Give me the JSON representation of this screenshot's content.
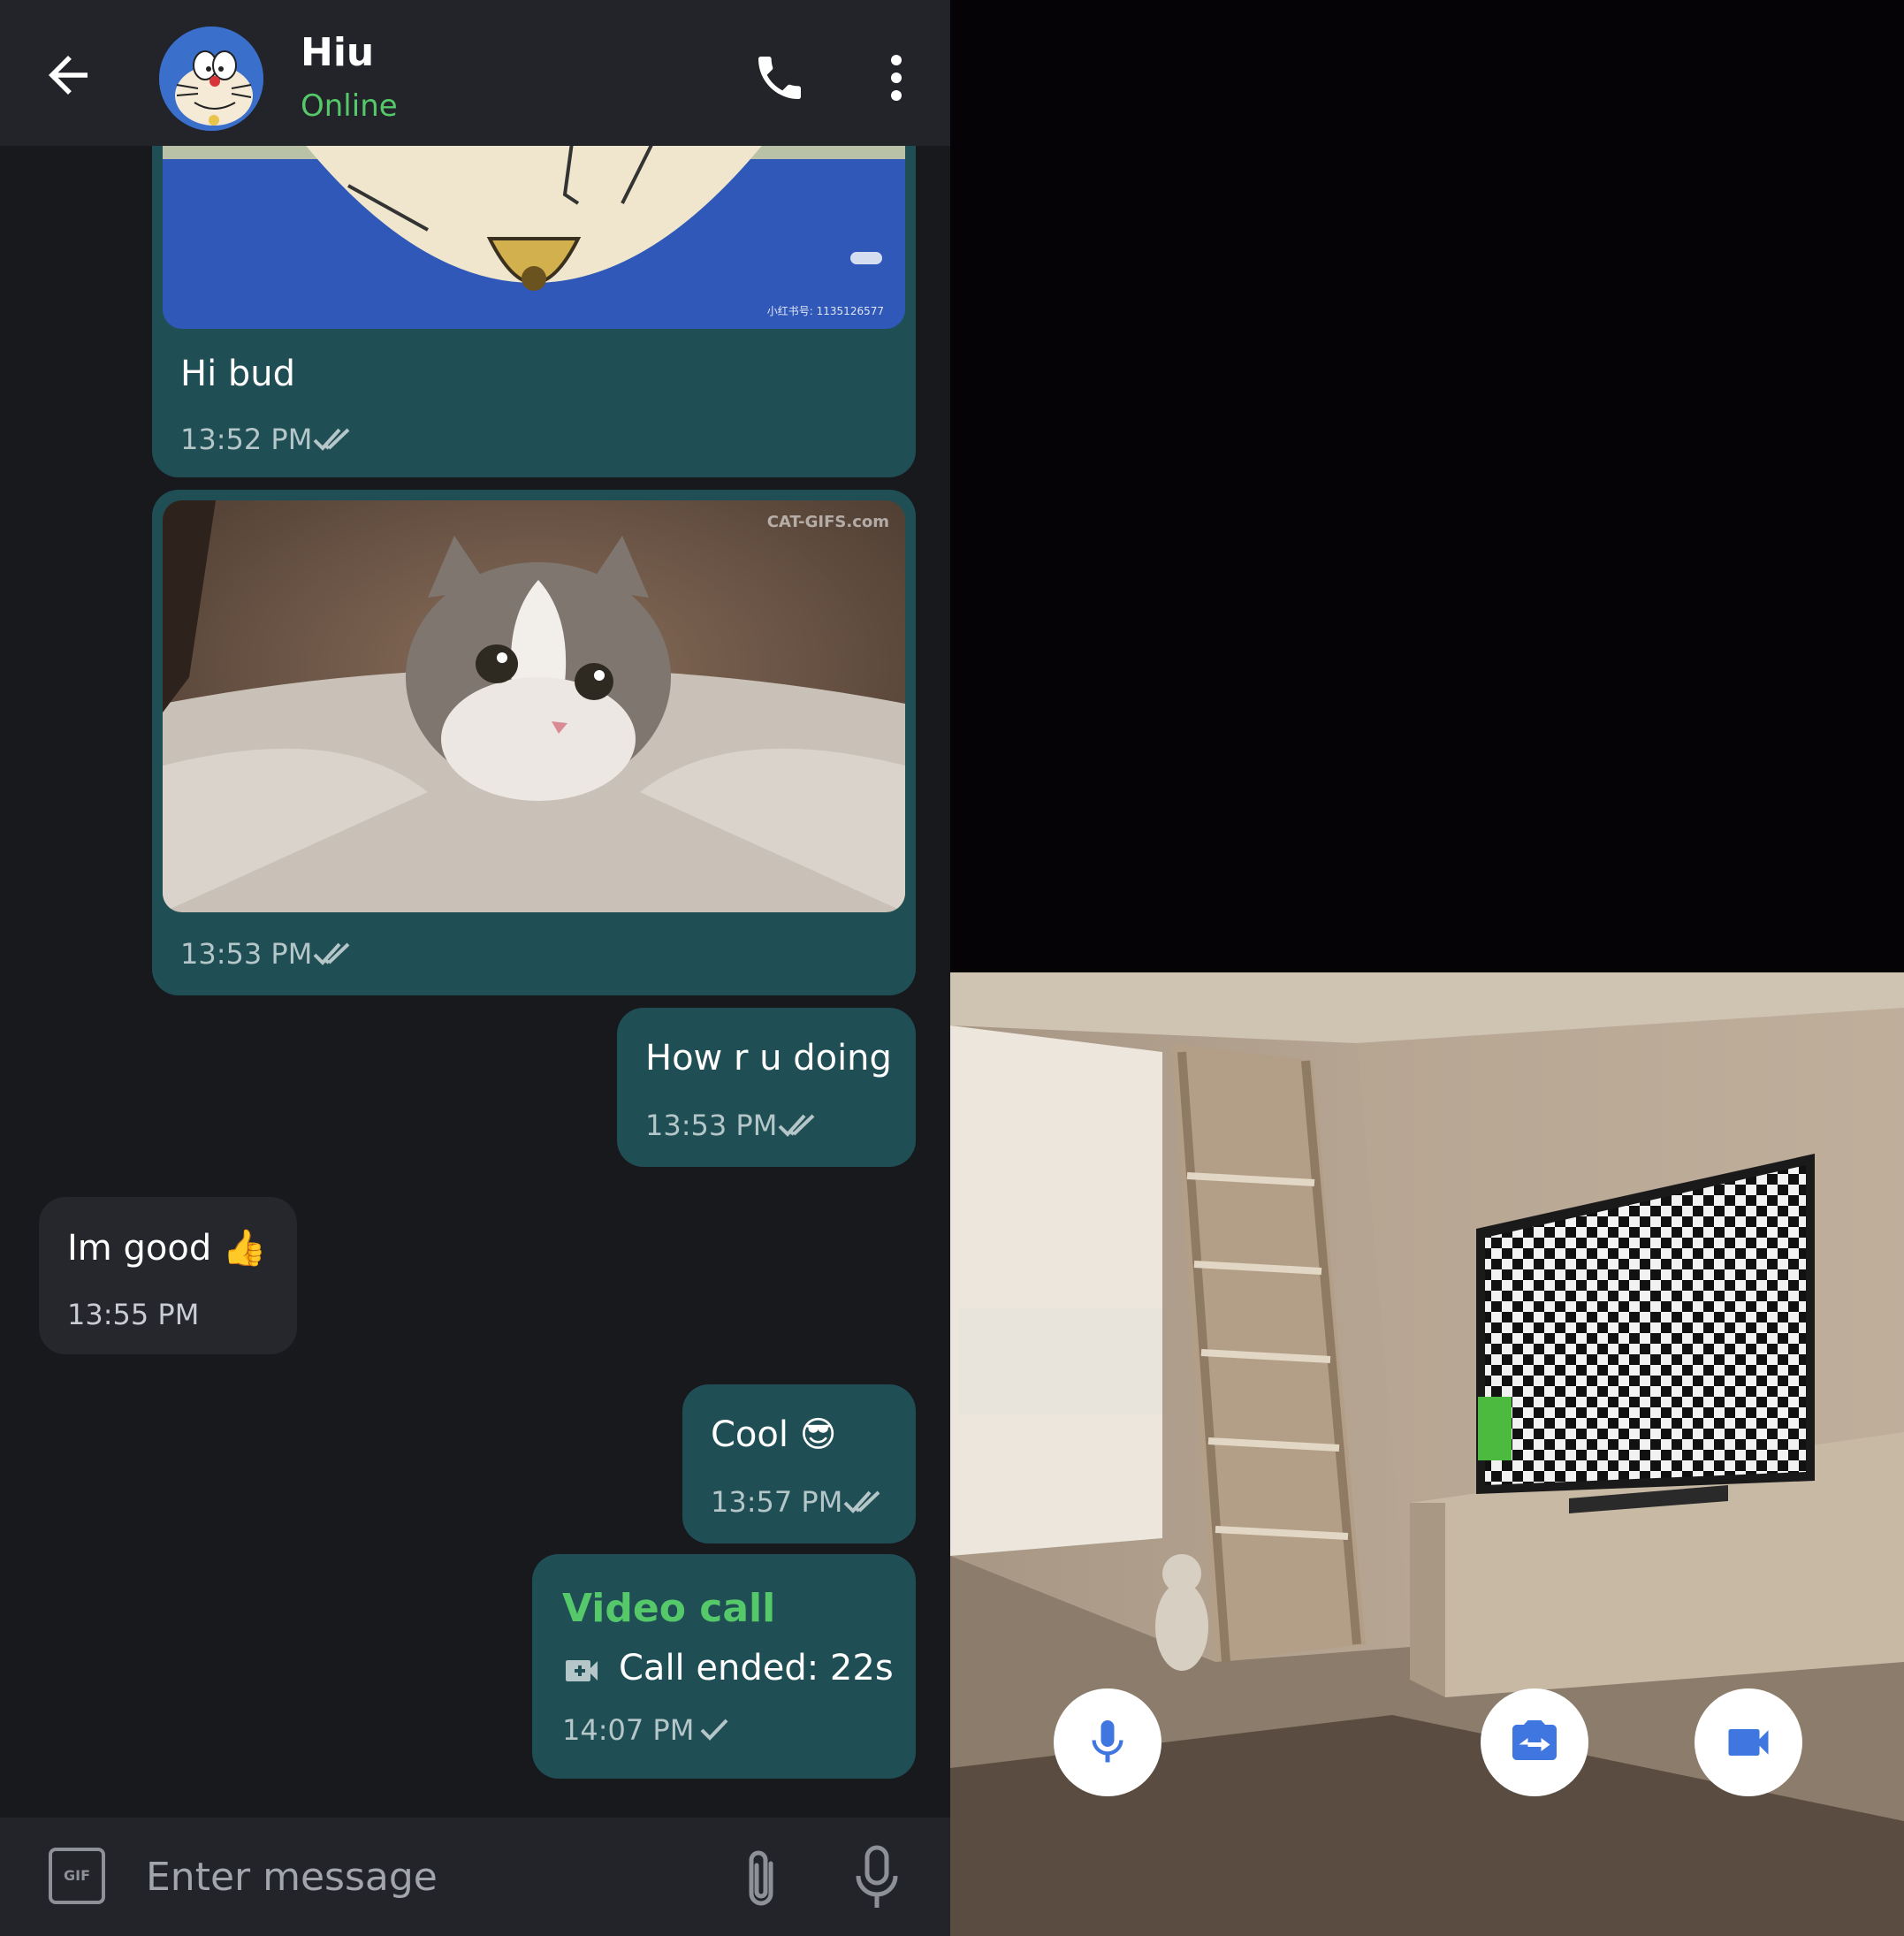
{
  "header": {
    "contact_name": "Hiu",
    "status": "Online"
  },
  "messages": [
    {
      "direction": "out",
      "type": "image",
      "caption": "Hi bud",
      "time": "13:52 PM",
      "status": "read",
      "image_watermark": "小红书号: 1135126577"
    },
    {
      "direction": "out",
      "type": "image",
      "caption": "",
      "time": "13:53 PM",
      "status": "read",
      "image_watermark": "CAT-GIFS.com"
    },
    {
      "direction": "out",
      "type": "text",
      "text": "How r u doing",
      "time": "13:53 PM",
      "status": "read"
    },
    {
      "direction": "in",
      "type": "text",
      "text": "Im good 👍",
      "time": "13:55 PM"
    },
    {
      "direction": "out",
      "type": "text",
      "text": "Cool 😎",
      "time": "13:57 PM",
      "status": "read"
    },
    {
      "direction": "out",
      "type": "call",
      "title": "Video call",
      "text": "Call ended: 22s",
      "time": "14:07 PM",
      "status": "sent"
    }
  ],
  "composer": {
    "gif_label": "GIF",
    "placeholder": "Enter message"
  },
  "call_controls": {
    "mic": "microphone-icon",
    "end": "end-call-icon",
    "switch_camera": "switch-camera-icon",
    "video": "video-camera-icon"
  },
  "colors": {
    "online": "#55c86a",
    "bubble_out": "#1f4f55",
    "bubble_in": "#25272d",
    "end_call": "#e35c59",
    "call_accent": "#3f76e0"
  }
}
